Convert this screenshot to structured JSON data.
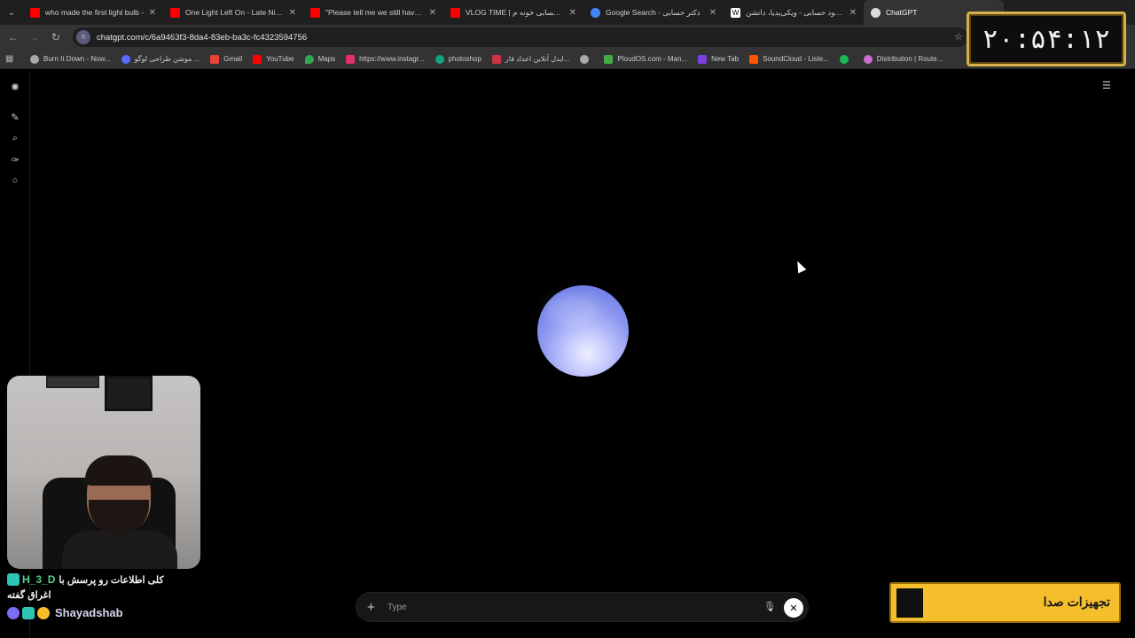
{
  "browser": {
    "tabs": [
      {
        "title": "who made the first light bulb -",
        "favicon_color": "#ff0000",
        "active": false
      },
      {
        "title": "One Light Left On - Late Night",
        "favicon_color": "#ff0000",
        "active": false
      },
      {
        "title": "\"Please tell me we still have co",
        "favicon_color": "#ff0000",
        "active": false
      },
      {
        "title": "VLOG TIME | دکتر حسابی خونه م",
        "favicon_color": "#ff0000",
        "active": false
      },
      {
        "title": "Google Search - دکتر حسابی",
        "favicon_color": "#4285f4",
        "active": false
      },
      {
        "title": "محمود حسابی - ویکی‌پدیا، دانشن",
        "favicon_color": "#ffffff",
        "active": false
      },
      {
        "title": "ChatGPT",
        "favicon_color": "#dddddd",
        "active": true
      }
    ],
    "url": "chatgpt.com/c/6a9463f3-8da4-83eb-ba3c-fc4323594756",
    "bookmarks": [
      {
        "label": "Burn It Down - Now...",
        "color": "#aaaaaa"
      },
      {
        "label": "موشن طراحی لوگو ...",
        "color": "#5b6cff"
      },
      {
        "label": "Gmail",
        "color": "#ea4335"
      },
      {
        "label": "YouTube",
        "color": "#ff0000"
      },
      {
        "label": "Maps",
        "color": "#34a853"
      },
      {
        "label": "https://www.instagr...",
        "color": "#e1306c"
      },
      {
        "label": "photoshop",
        "color": "#10a37f"
      },
      {
        "label": "ایدل آنلاین اعداد فار...",
        "color": "#cc3344"
      },
      {
        "label": "",
        "color": "#aaaaaa"
      },
      {
        "label": "PloudOS.com - Man...",
        "color": "#44aa44"
      },
      {
        "label": "New Tab",
        "color": "#7b3fe4"
      },
      {
        "label": "SoundCloud - Liste...",
        "color": "#ff5500"
      },
      {
        "label": "",
        "color": "#1db954"
      },
      {
        "label": "Distribution | Route...",
        "color": "#c86fd0"
      }
    ]
  },
  "composer": {
    "placeholder": "Type"
  },
  "overlay": {
    "timer": "۲۰:۵۴:۱۲",
    "banner_text": "تجهیزات صدا",
    "chat": {
      "user1": "H_3_D",
      "message1": "کلی اطلاعات رو پرسش با",
      "message1_cont": "اغراق گفته",
      "user2": "Shayadshab"
    }
  },
  "colors": {
    "orb": "#8b97f0",
    "chat_user": "#4fd38d",
    "banner": "#f4bf2a",
    "timer_border": "#d8b04a"
  }
}
